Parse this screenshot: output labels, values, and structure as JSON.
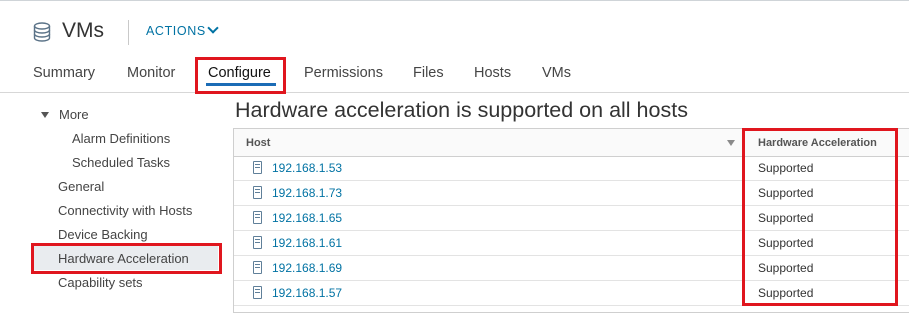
{
  "header": {
    "title": "VMs",
    "actions_label": "ACTIONS",
    "icon": "datastore-icon"
  },
  "tabs": [
    {
      "label": "Summary"
    },
    {
      "label": "Monitor"
    },
    {
      "label": "Configure",
      "active": true
    },
    {
      "label": "Permissions"
    },
    {
      "label": "Files"
    },
    {
      "label": "Hosts"
    },
    {
      "label": "VMs"
    }
  ],
  "sidebar": {
    "items": [
      {
        "label": "More",
        "expanded": true
      },
      {
        "label": "Alarm Definitions"
      },
      {
        "label": "Scheduled Tasks"
      },
      {
        "label": "General"
      },
      {
        "label": "Connectivity with Hosts"
      },
      {
        "label": "Device Backing"
      },
      {
        "label": "Hardware Acceleration",
        "selected": true
      },
      {
        "label": "Capability sets"
      }
    ]
  },
  "main": {
    "heading": "Hardware acceleration is supported on all hosts",
    "table": {
      "columns": [
        "Host",
        "Hardware Acceleration"
      ],
      "rows": [
        {
          "host": "192.168.1.53",
          "hw": "Supported"
        },
        {
          "host": "192.168.1.73",
          "hw": "Supported"
        },
        {
          "host": "192.168.1.65",
          "hw": "Supported"
        },
        {
          "host": "192.168.1.61",
          "hw": "Supported"
        },
        {
          "host": "192.168.1.69",
          "hw": "Supported"
        },
        {
          "host": "192.168.1.57",
          "hw": "Supported"
        }
      ]
    }
  },
  "colors": {
    "link": "#0072a3",
    "highlight_box": "#e0161e",
    "active_tab_underline": "#1b6cb6",
    "selected_bg": "#e9ecef"
  }
}
